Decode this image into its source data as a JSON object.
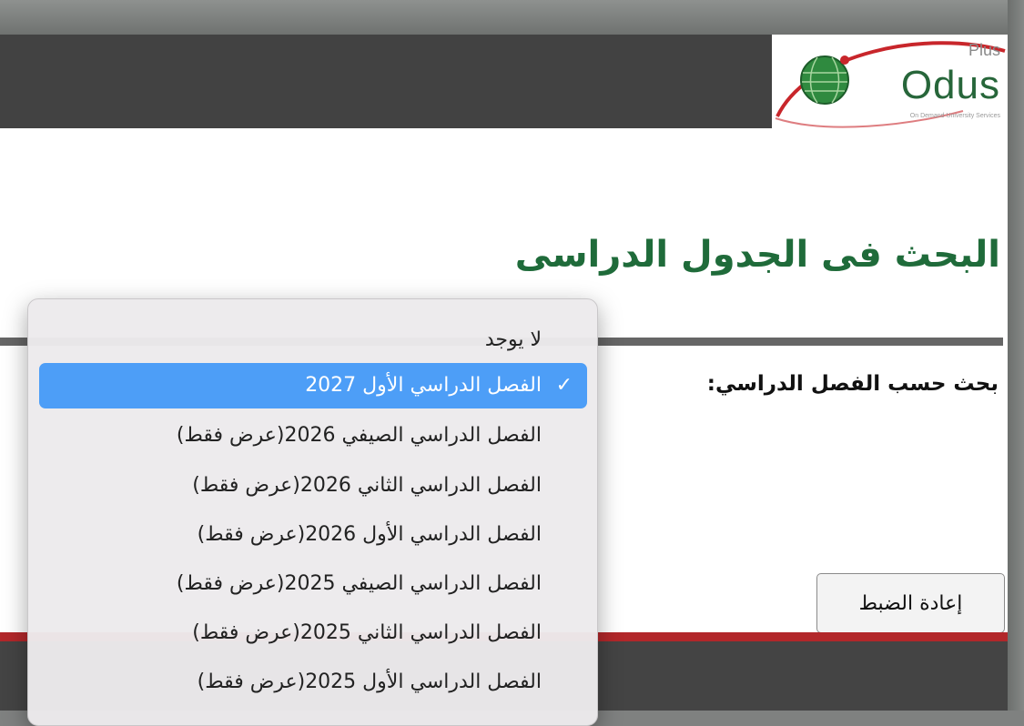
{
  "logo": {
    "word": "Odus",
    "plus": "Plus",
    "tagline": "On Demand University Services"
  },
  "search": {
    "title": "البحث فى الجدول الدراسى",
    "by_semester_label": "بحث حسب الفصل الدراسي:",
    "reset_label": "إعادة الضبط"
  },
  "dropdown": {
    "options": [
      {
        "label": "لا يوجد",
        "selected": false
      },
      {
        "label": "الفصل الدراسي الأول 2027",
        "selected": true
      },
      {
        "label": "الفصل الدراسي الصيفي 2026(عرض فقط)",
        "selected": false
      },
      {
        "label": "الفصل الدراسي الثاني 2026(عرض فقط)",
        "selected": false
      },
      {
        "label": "الفصل الدراسي الأول 2026(عرض فقط)",
        "selected": false
      },
      {
        "label": "الفصل الدراسي الصيفي 2025(عرض فقط)",
        "selected": false
      },
      {
        "label": "الفصل الدراسي الثاني 2025(عرض فقط)",
        "selected": false
      },
      {
        "label": "الفصل الدراسي الأول 2025(عرض فقط)",
        "selected": false
      }
    ],
    "check_glyph": "✓"
  },
  "colors": {
    "title_green": "#1f6b3a",
    "header_dark": "#424242",
    "footer_red": "#b2272a",
    "selection_blue": "#4d9ef7"
  }
}
